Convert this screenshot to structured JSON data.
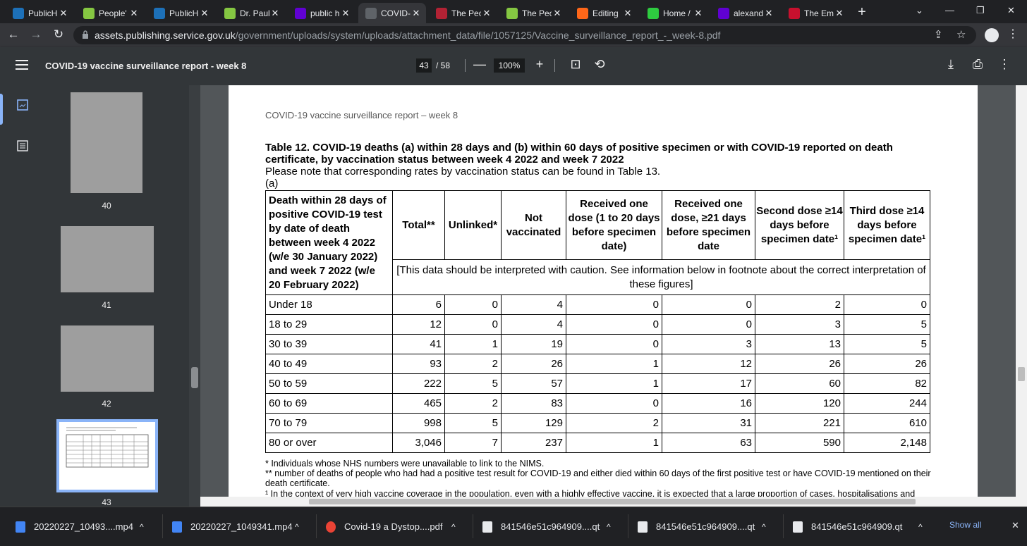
{
  "tabs": [
    {
      "title": "PublicH",
      "favicon": "ukhsa-icon",
      "color": "#1d70b8"
    },
    {
      "title": "People'",
      "favicon": "rumble-icon",
      "color": "#85c742"
    },
    {
      "title": "PublicH",
      "favicon": "ukhsa-icon",
      "color": "#1d70b8"
    },
    {
      "title": "Dr. Paul",
      "favicon": "rumble-icon",
      "color": "#85c742"
    },
    {
      "title": "public h",
      "favicon": "yahoo-icon",
      "color": "#6001d2"
    },
    {
      "title": "COVID-",
      "favicon": "crown-icon",
      "color": "#5f6368"
    },
    {
      "title": "The Peo",
      "favicon": "us-flag-icon",
      "color": "#b22234"
    },
    {
      "title": "The Peo",
      "favicon": "rumble-icon",
      "color": "#85c742"
    },
    {
      "title": "Editing",
      "favicon": "substack-icon",
      "color": "#ff6719"
    },
    {
      "title": "Home /",
      "favicon": "gettr-icon",
      "color": "#2ecc40"
    },
    {
      "title": "alexand",
      "favicon": "yahoo-icon",
      "color": "#6001d2"
    },
    {
      "title": "The Em",
      "favicon": "bi-icon",
      "color": "#c8102e"
    }
  ],
  "address": {
    "host": "assets.publishing.service.gov.uk",
    "path": "/government/uploads/system/uploads/attachment_data/file/1057125/Vaccine_surveillance_report_-_week-8.pdf"
  },
  "pdf_toolbar": {
    "title": "COVID-19 vaccine surveillance report - week 8",
    "current_page": "43",
    "total_pages": "/ 58",
    "zoom": "100%"
  },
  "thumbnails": [
    {
      "label": "40"
    },
    {
      "label": "41"
    },
    {
      "label": "42"
    },
    {
      "label": "43"
    }
  ],
  "page": {
    "running_header": "COVID-19 vaccine surveillance report – week 8",
    "table_title": "Table 12. COVID-19 deaths (a) within 28 days and (b) within 60 days of positive specimen or with COVID-19 reported on death certificate, by vaccination status between week 4 2022 and week 7 2022",
    "note": "Please note that corresponding rates by vaccination status can be found in Table 13.",
    "part": "(a)",
    "row_header": "Death within 28 days of positive COVID-19 test by date of death between week 4 2022 (w/e 30 January 2022) and week 7 2022 (w/e 20 February 2022)",
    "columns": [
      "Total**",
      "Unlinked*",
      "Not vaccinated",
      "Received one dose (1 to 20 days before specimen date)",
      "Received one dose, ≥21 days before specimen date",
      "Second dose ≥14 days before specimen date¹",
      "Third dose ≥14 days before specimen date¹"
    ],
    "caveat": "[This data should be interpreted with caution. See information below in footnote about the correct interpretation of these figures]",
    "rows": [
      {
        "label": "Under 18",
        "values": [
          "6",
          "0",
          "4",
          "0",
          "0",
          "2",
          "0"
        ]
      },
      {
        "label": "18 to 29",
        "values": [
          "12",
          "0",
          "4",
          "0",
          "0",
          "3",
          "5"
        ]
      },
      {
        "label": "30 to 39",
        "values": [
          "41",
          "1",
          "19",
          "0",
          "3",
          "13",
          "5"
        ]
      },
      {
        "label": "40 to 49",
        "values": [
          "93",
          "2",
          "26",
          "1",
          "12",
          "26",
          "26"
        ]
      },
      {
        "label": "50 to 59",
        "values": [
          "222",
          "5",
          "57",
          "1",
          "17",
          "60",
          "82"
        ]
      },
      {
        "label": "60 to 69",
        "values": [
          "465",
          "2",
          "83",
          "0",
          "16",
          "120",
          "244"
        ]
      },
      {
        "label": "70 to 79",
        "values": [
          "998",
          "5",
          "129",
          "2",
          "31",
          "221",
          "610"
        ]
      },
      {
        "label": "80 or over",
        "values": [
          "3,046",
          "7",
          "237",
          "1",
          "63",
          "590",
          "2,148"
        ]
      }
    ],
    "footnotes": [
      "* Individuals whose NHS numbers were unavailable to link to the NIMS.",
      "** number of deaths of people who had had a positive test result for COVID-19 and either died within 60 days of the first positive test or have COVID-19 mentioned on their death certificate.",
      "¹ In the context of very high vaccine coverage in the population, even with a highly effective vaccine, it is expected that a large proportion of cases, hospitalisations and"
    ]
  },
  "downloads": [
    {
      "name": "20220227_10493....mp4",
      "icon": "video-file-icon"
    },
    {
      "name": "20220227_1049341.mp4",
      "icon": "video-file-icon"
    },
    {
      "name": "Covid-19 a Dystop....pdf",
      "icon": "chrome-icon"
    },
    {
      "name": "841546e51c964909....qt",
      "icon": "file-icon"
    },
    {
      "name": "841546e51c964909....qt",
      "icon": "file-icon"
    },
    {
      "name": "841546e51c964909.qt",
      "icon": "file-icon"
    }
  ],
  "show_all": "Show all"
}
